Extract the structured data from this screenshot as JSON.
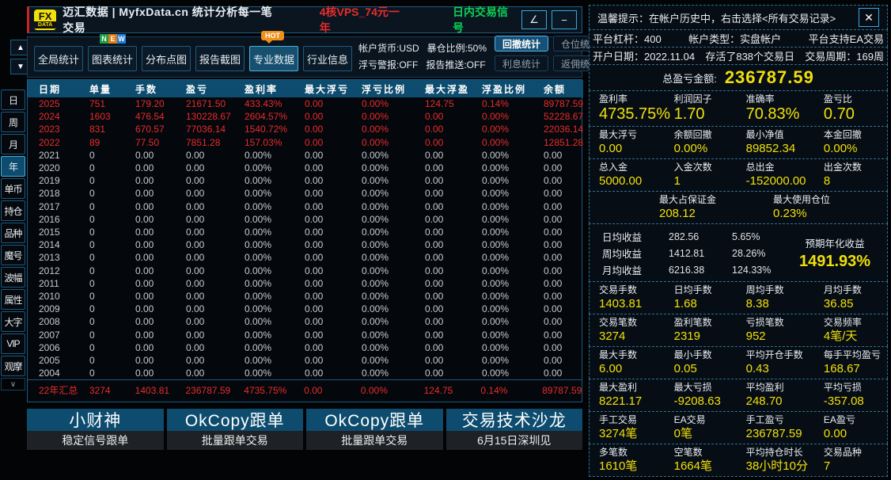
{
  "titlebar": {
    "logo_top": "FX",
    "logo_bottom": "DATA",
    "title": "迈汇数据 | MyfxData.cn  统计分析每一笔交易",
    "promo": "4核VPS_74元一年",
    "signal": "日内交易信号",
    "angle_button": "∠",
    "minimize_button": "−"
  },
  "toolbar": {
    "tabs": [
      {
        "label": "全局统计",
        "active": false,
        "badge": ""
      },
      {
        "label": "图表统计",
        "active": false,
        "badge": "NEW"
      },
      {
        "label": "分布点图",
        "active": false,
        "badge": ""
      },
      {
        "label": "报告截图",
        "active": false,
        "badge": ""
      },
      {
        "label": "专业数据",
        "active": true,
        "badge": "HOT"
      },
      {
        "label": "行业信息",
        "active": false,
        "badge": ""
      }
    ],
    "new_badge_letters": [
      "N",
      "E",
      "W"
    ],
    "hot_badge": "HOT",
    "info_lines": [
      [
        "帐户货币:USD",
        "暴仓比例:50%"
      ],
      [
        "浮亏警报:OFF",
        "报告推送:OFF"
      ]
    ],
    "stat_buttons": [
      {
        "label": "回撤统计",
        "active": true
      },
      {
        "label": "仓位统计",
        "active": false
      },
      {
        "label": "利息统计",
        "active": false
      },
      {
        "label": "返佣统计",
        "active": false
      }
    ],
    "scroll_up": "▲",
    "scroll_down": "▼"
  },
  "sidebar": {
    "items": [
      {
        "label": "日",
        "active": false
      },
      {
        "label": "周",
        "active": false
      },
      {
        "label": "月",
        "active": false
      },
      {
        "label": "年",
        "active": true
      },
      {
        "label": "单币",
        "active": false
      },
      {
        "label": "持仓",
        "active": false
      },
      {
        "label": "品种",
        "active": false
      },
      {
        "label": "魔号",
        "active": false
      },
      {
        "label": "波幅",
        "active": false
      },
      {
        "label": "属性",
        "active": false
      },
      {
        "label": "大字",
        "active": false
      },
      {
        "label": "VIP",
        "active": false
      },
      {
        "label": "观摩",
        "active": false
      }
    ],
    "more": "∨"
  },
  "table": {
    "headers": [
      "日期",
      "单量",
      "手数",
      "盈亏",
      "盈利率",
      "最大浮亏",
      "浮亏比例",
      "最大浮盈",
      "浮盈比例",
      "余额"
    ],
    "rows": [
      {
        "highlight": true,
        "cells": [
          "2025",
          "751",
          "179.20",
          "21671.50",
          "433.43%",
          "0.00",
          "0.00%",
          "124.75",
          "0.14%",
          "89787.59"
        ]
      },
      {
        "highlight": true,
        "cells": [
          "2024",
          "1603",
          "476.54",
          "130228.67",
          "2604.57%",
          "0.00",
          "0.00%",
          "0.00",
          "0.00%",
          "52228.67"
        ]
      },
      {
        "highlight": true,
        "cells": [
          "2023",
          "831",
          "670.57",
          "77036.14",
          "1540.72%",
          "0.00",
          "0.00%",
          "0.00",
          "0.00%",
          "22036.14"
        ]
      },
      {
        "highlight": true,
        "cells": [
          "2022",
          "89",
          "77.50",
          "7851.28",
          "157.03%",
          "0.00",
          "0.00%",
          "0.00",
          "0.00%",
          "12851.28"
        ]
      },
      {
        "highlight": false,
        "cells": [
          "2021",
          "0",
          "0.00",
          "0.00",
          "0.00%",
          "0.00",
          "0.00%",
          "0.00",
          "0.00%",
          "0.00"
        ]
      },
      {
        "highlight": false,
        "cells": [
          "2020",
          "0",
          "0.00",
          "0.00",
          "0.00%",
          "0.00",
          "0.00%",
          "0.00",
          "0.00%",
          "0.00"
        ]
      },
      {
        "highlight": false,
        "cells": [
          "2019",
          "0",
          "0.00",
          "0.00",
          "0.00%",
          "0.00",
          "0.00%",
          "0.00",
          "0.00%",
          "0.00"
        ]
      },
      {
        "highlight": false,
        "cells": [
          "2018",
          "0",
          "0.00",
          "0.00",
          "0.00%",
          "0.00",
          "0.00%",
          "0.00",
          "0.00%",
          "0.00"
        ]
      },
      {
        "highlight": false,
        "cells": [
          "2017",
          "0",
          "0.00",
          "0.00",
          "0.00%",
          "0.00",
          "0.00%",
          "0.00",
          "0.00%",
          "0.00"
        ]
      },
      {
        "highlight": false,
        "cells": [
          "2016",
          "0",
          "0.00",
          "0.00",
          "0.00%",
          "0.00",
          "0.00%",
          "0.00",
          "0.00%",
          "0.00"
        ]
      },
      {
        "highlight": false,
        "cells": [
          "2015",
          "0",
          "0.00",
          "0.00",
          "0.00%",
          "0.00",
          "0.00%",
          "0.00",
          "0.00%",
          "0.00"
        ]
      },
      {
        "highlight": false,
        "cells": [
          "2014",
          "0",
          "0.00",
          "0.00",
          "0.00%",
          "0.00",
          "0.00%",
          "0.00",
          "0.00%",
          "0.00"
        ]
      },
      {
        "highlight": false,
        "cells": [
          "2013",
          "0",
          "0.00",
          "0.00",
          "0.00%",
          "0.00",
          "0.00%",
          "0.00",
          "0.00%",
          "0.00"
        ]
      },
      {
        "highlight": false,
        "cells": [
          "2012",
          "0",
          "0.00",
          "0.00",
          "0.00%",
          "0.00",
          "0.00%",
          "0.00",
          "0.00%",
          "0.00"
        ]
      },
      {
        "highlight": false,
        "cells": [
          "2011",
          "0",
          "0.00",
          "0.00",
          "0.00%",
          "0.00",
          "0.00%",
          "0.00",
          "0.00%",
          "0.00"
        ]
      },
      {
        "highlight": false,
        "cells": [
          "2010",
          "0",
          "0.00",
          "0.00",
          "0.00%",
          "0.00",
          "0.00%",
          "0.00",
          "0.00%",
          "0.00"
        ]
      },
      {
        "highlight": false,
        "cells": [
          "2009",
          "0",
          "0.00",
          "0.00",
          "0.00%",
          "0.00",
          "0.00%",
          "0.00",
          "0.00%",
          "0.00"
        ]
      },
      {
        "highlight": false,
        "cells": [
          "2008",
          "0",
          "0.00",
          "0.00",
          "0.00%",
          "0.00",
          "0.00%",
          "0.00",
          "0.00%",
          "0.00"
        ]
      },
      {
        "highlight": false,
        "cells": [
          "2007",
          "0",
          "0.00",
          "0.00",
          "0.00%",
          "0.00",
          "0.00%",
          "0.00",
          "0.00%",
          "0.00"
        ]
      },
      {
        "highlight": false,
        "cells": [
          "2006",
          "0",
          "0.00",
          "0.00",
          "0.00%",
          "0.00",
          "0.00%",
          "0.00",
          "0.00%",
          "0.00"
        ]
      },
      {
        "highlight": false,
        "cells": [
          "2005",
          "0",
          "0.00",
          "0.00",
          "0.00%",
          "0.00",
          "0.00%",
          "0.00",
          "0.00%",
          "0.00"
        ]
      },
      {
        "highlight": false,
        "cells": [
          "2004",
          "0",
          "0.00",
          "0.00",
          "0.00%",
          "0.00",
          "0.00%",
          "0.00",
          "0.00%",
          "0.00"
        ]
      }
    ],
    "summary": [
      "22年汇总",
      "3274",
      "1403.81",
      "236787.59",
      "4735.75%",
      "0.00",
      "0.00%",
      "124.75",
      "0.14%",
      "89787.59"
    ]
  },
  "banners": [
    {
      "title": "小财神",
      "subtitle": "稳定信号跟单"
    },
    {
      "title": "OkCopy跟单",
      "subtitle": "批量跟单交易"
    },
    {
      "title": "OkCopy跟单",
      "subtitle": "批量跟单交易"
    },
    {
      "title": "交易技术沙龙",
      "subtitle": "6月15日深圳见"
    }
  ],
  "right_panel": {
    "notice": "温馨提示：在帐户历史中，右击选择<所有交易记录>",
    "close_label": "✕",
    "info_rows": [
      [
        "平台杠杆：400",
        "帐户类型：实盘帐户",
        "平台支持EA交易"
      ],
      [
        "开户日期：2022.11.04",
        "存活了838个交易日",
        "交易周期：169周"
      ]
    ],
    "total_label": "总盈亏金额:",
    "total_value": "236787.59",
    "sections": [
      {
        "type": "stats4",
        "big": true,
        "cells": [
          {
            "l": "盈利率",
            "v": "4735.75%"
          },
          {
            "l": "利润因子",
            "v": "1.70"
          },
          {
            "l": "准确率",
            "v": "70.83%"
          },
          {
            "l": "盈亏比",
            "v": "0.70"
          }
        ]
      },
      {
        "type": "stats4",
        "big": false,
        "cells": [
          {
            "l": "最大浮亏",
            "v": "0.00"
          },
          {
            "l": "余额回撤",
            "v": "0.00%"
          },
          {
            "l": "最小净值",
            "v": "89852.34"
          },
          {
            "l": "本金回撤",
            "v": "0.00%"
          }
        ]
      },
      {
        "type": "stats4",
        "big": false,
        "cells": [
          {
            "l": "总入金",
            "v": "5000.00"
          },
          {
            "l": "入金次数",
            "v": "1"
          },
          {
            "l": "总出金",
            "v": "-152000.00"
          },
          {
            "l": "出金次数",
            "v": "8"
          }
        ]
      },
      {
        "type": "margin",
        "cells": [
          {
            "l": "最大占保证金",
            "v": "208.12"
          },
          {
            "l": "最大使用仓位",
            "v": "0.23%"
          }
        ]
      },
      {
        "type": "income",
        "rows": [
          [
            "日均收益",
            "282.56",
            "5.65%"
          ],
          [
            "周均收益",
            "1412.81",
            "28.26%"
          ],
          [
            "月均收益",
            "6216.38",
            "124.33%"
          ]
        ],
        "annual_label": "预期年化收益",
        "annual_value": "1491.93%"
      },
      {
        "type": "stats4",
        "big": false,
        "cells": [
          {
            "l": "交易手数",
            "v": "1403.81"
          },
          {
            "l": "日均手数",
            "v": "1.68"
          },
          {
            "l": "周均手数",
            "v": "8.38"
          },
          {
            "l": "月均手数",
            "v": "36.85"
          }
        ]
      },
      {
        "type": "stats4",
        "big": false,
        "cells": [
          {
            "l": "交易笔数",
            "v": "3274"
          },
          {
            "l": "盈利笔数",
            "v": "2319"
          },
          {
            "l": "亏损笔数",
            "v": "952"
          },
          {
            "l": "交易频率",
            "v": "4笔/天"
          }
        ]
      },
      {
        "type": "stats4",
        "big": false,
        "cells": [
          {
            "l": "最大手数",
            "v": "6.00"
          },
          {
            "l": "最小手数",
            "v": "0.05"
          },
          {
            "l": "平均开仓手数",
            "v": "0.43"
          },
          {
            "l": "每手平均盈亏",
            "v": "168.67"
          }
        ]
      },
      {
        "type": "stats4",
        "big": false,
        "cells": [
          {
            "l": "最大盈利",
            "v": "8221.17"
          },
          {
            "l": "最大亏损",
            "v": "-9208.63"
          },
          {
            "l": "平均盈利",
            "v": "248.70"
          },
          {
            "l": "平均亏损",
            "v": "-357.08"
          }
        ]
      },
      {
        "type": "stats4",
        "big": false,
        "cells": [
          {
            "l": "手工交易",
            "v": "3274笔"
          },
          {
            "l": "EA交易",
            "v": "0笔"
          },
          {
            "l": "手工盈亏",
            "v": "236787.59"
          },
          {
            "l": "EA盈亏",
            "v": "0.00"
          }
        ]
      },
      {
        "type": "stats4",
        "big": false,
        "cells": [
          {
            "l": "多笔数",
            "v": "1610笔"
          },
          {
            "l": "空笔数",
            "v": "1664笔"
          },
          {
            "l": "平均持仓时长",
            "v": "38小时10分"
          },
          {
            "l": "交易品种",
            "v": "7"
          }
        ]
      }
    ]
  },
  "colors": {
    "accent_teal": "#0d4c6e",
    "red": "#e82c2c",
    "yellow": "#f0e00a",
    "green": "#0ad254",
    "border_blue": "#1c5a82"
  }
}
